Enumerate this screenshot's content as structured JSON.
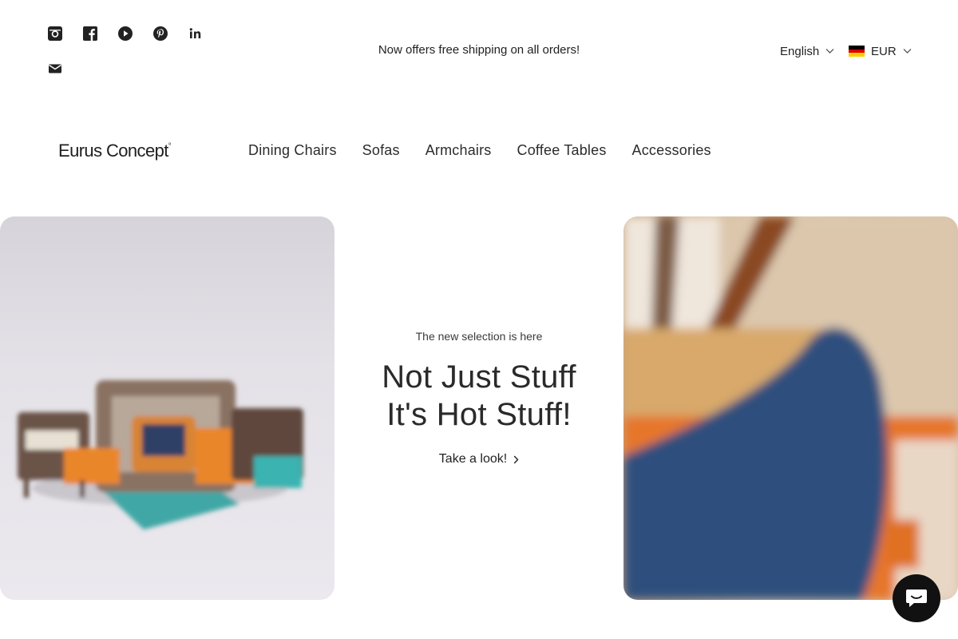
{
  "social": {
    "icons": [
      "instagram-icon",
      "facebook-icon",
      "youtube-icon",
      "pinterest-icon",
      "linkedin-icon",
      "email-icon"
    ]
  },
  "announcement": {
    "text": "Now offers free shipping on all orders!"
  },
  "localization": {
    "language": "English",
    "currency": "EUR",
    "flag_colors": [
      "#000000",
      "#dd0000",
      "#ffce00"
    ]
  },
  "header": {
    "logo": "Eurus Concept",
    "logo_mark": "°",
    "nav": [
      "Dining Chairs",
      "Sofas",
      "Armchairs",
      "Coffee Tables",
      "Accessories"
    ]
  },
  "hero": {
    "eyebrow": "The new selection is here",
    "headline_line1": "Not Just Stuff",
    "headline_line2": "It's Hot Stuff!",
    "cta": "Take a look!"
  },
  "colors": {
    "text": "#222222",
    "chat_bg": "#111111",
    "accent_orange": "#e8742a",
    "accent_blue": "#2e4a78"
  }
}
